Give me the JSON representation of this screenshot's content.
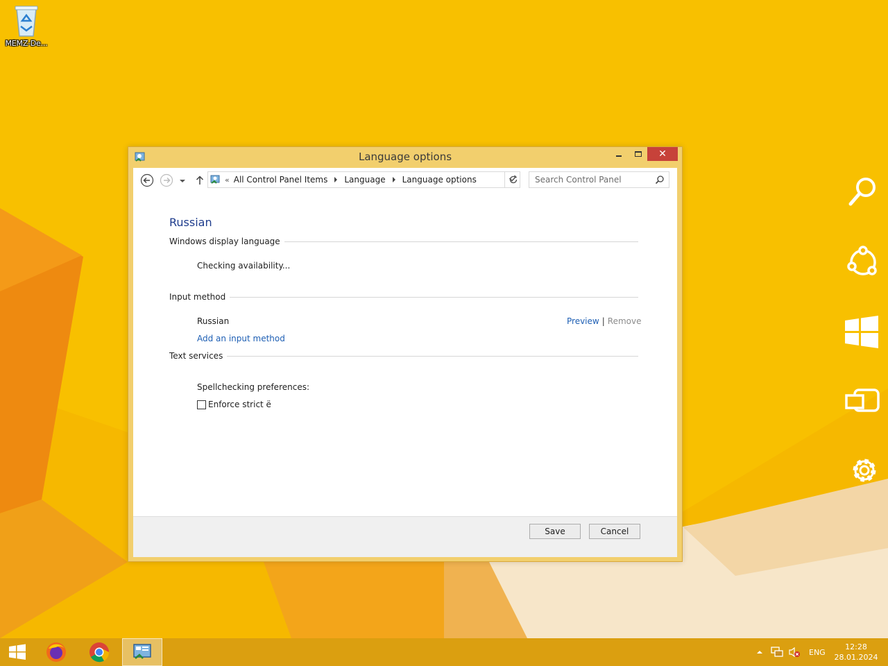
{
  "desktop": {
    "icon_label": "MEMZ-De..."
  },
  "window": {
    "title": "Language options",
    "close_glyph": "✕"
  },
  "nav": {
    "overflow_glyph": "«",
    "breadcrumbs": [
      "All Control Panel Items",
      "Language",
      "Language options"
    ],
    "search_placeholder": "Search Control Panel"
  },
  "content": {
    "language_name": "Russian",
    "sections": {
      "display_language": {
        "heading": "Windows display language",
        "status": "Checking availability..."
      },
      "input_method": {
        "heading": "Input method",
        "method_name": "Russian",
        "preview_link": "Preview",
        "separator": "|",
        "remove_link": "Remove",
        "add_link": "Add an input method"
      },
      "text_services": {
        "heading": "Text services",
        "spellcheck_label": "Spellchecking preferences:",
        "enforce_label": "Enforce strict ё",
        "enforce_checked": false
      }
    }
  },
  "footer": {
    "save_label": "Save",
    "cancel_label": "Cancel"
  },
  "charms": [
    "search-icon",
    "share-icon",
    "start-icon",
    "devices-icon",
    "settings-icon"
  ],
  "taskbar": {
    "items": [
      "windows-logo-icon",
      "firefox-icon",
      "chrome-icon",
      "control-panel-icon"
    ],
    "tray": {
      "language": "ENG",
      "time": "12:28",
      "date": "28.01.2024"
    }
  },
  "colors": {
    "desktop_bg": "#f5b800",
    "window_frame": "#f2cf6d",
    "close_button": "#c7423a",
    "link": "#1e5fb4",
    "heading": "#1e3c8c"
  }
}
